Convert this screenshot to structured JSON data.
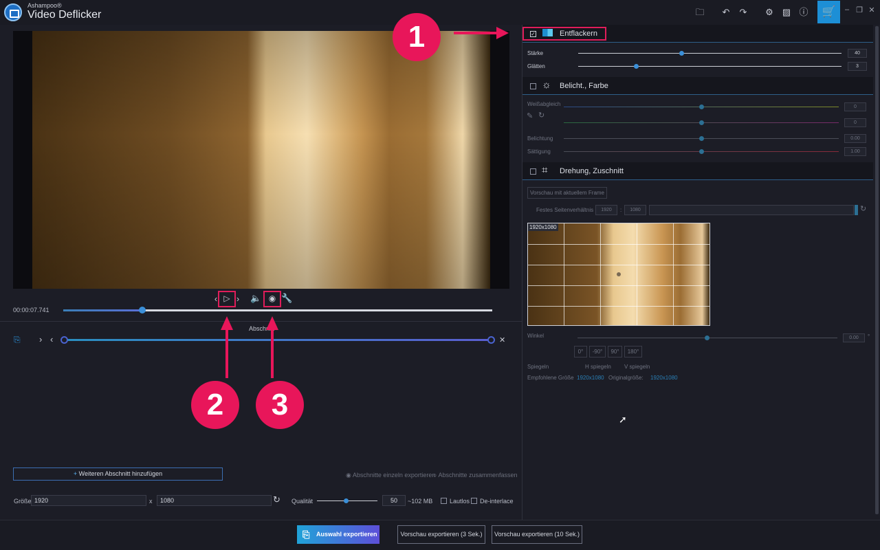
{
  "app": {
    "brand": "Ashampoo®",
    "name": "Video Deflicker"
  },
  "toolbar": {
    "icons": [
      "folder-icon",
      "undo-icon",
      "redo-icon",
      "settings-icon",
      "image-icon",
      "info-icon",
      "cart-icon"
    ]
  },
  "player": {
    "time": "00:00:07.741",
    "progress": 0.18
  },
  "timeline": {
    "section_label": "Abschnitt"
  },
  "left_bottom": {
    "add_section": "Weiteren Abschnitt hinzufügen",
    "radio1": "Abschnitte einzeln exportieren",
    "radio2": "Abschnitte zusammenfassen",
    "size_label": "Größe",
    "width": "1920",
    "height": "1080",
    "x": "x",
    "quality_label": "Qualität",
    "quality_value": "50",
    "quality_size": "~102 MB",
    "mute_label": "Lautlos",
    "deinterlace_label": "De-interlace"
  },
  "export": {
    "main": "Auswahl exportieren",
    "preview3": "Vorschau exportieren (3 Sek.)",
    "preview10": "Vorschau exportieren (10 Sek.)"
  },
  "deflicker": {
    "title": "Entflackern",
    "checked": true,
    "strength_label": "Stärke",
    "strength_value": "40",
    "smooth_label": "Glätten",
    "smooth_value": "3"
  },
  "exposure": {
    "title": "Belicht., Farbe",
    "whitebalance_label": "Weißabgleich",
    "wb1": "0",
    "wb2": "0",
    "exposure_label": "Belichtung",
    "exposure_value": "0.00",
    "saturation_label": "Sättigung",
    "saturation_value": "1.00"
  },
  "crop": {
    "title": "Drehung, Zuschnitt",
    "preview_btn": "Vorschau mit aktuellem Frame",
    "ratio_label": "Festes Seitenverhältnis",
    "ratio_w": "1920",
    "ratio_sep": ":",
    "ratio_h": "1080",
    "thumb_label": "1920x1080",
    "angle_label": "Winkel",
    "angle_value": "0.00",
    "angle_unit": "°",
    "rot0": "0°",
    "rotm90": "-90°",
    "rot90": "90°",
    "rot180": "180°",
    "mirror_label": "Spiegeln",
    "mirror_h": "H spiegeln",
    "mirror_v": "V spiegeln",
    "recommended_label": "Empfohlene Größe",
    "recommended_value": "1920x1080",
    "original_label": "Originalgröße:",
    "original_value": "1920x1080"
  },
  "callouts": {
    "one": "1",
    "two": "2",
    "three": "3"
  },
  "colors": {
    "accent": "#1d8fd6",
    "highlight": "#e01d5a"
  }
}
